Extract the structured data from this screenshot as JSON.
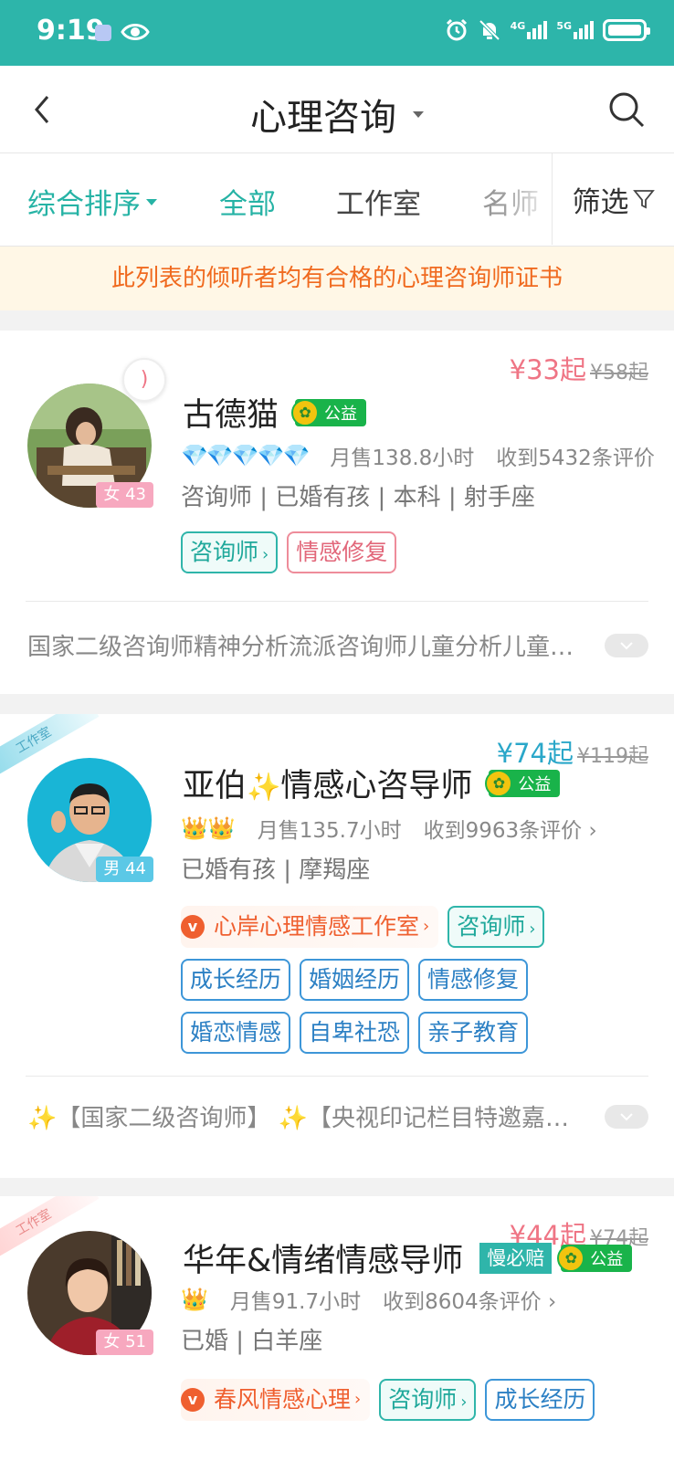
{
  "status_bar": {
    "time": "9:19",
    "net_4g": "4G",
    "net_5g": "5G"
  },
  "nav": {
    "title": "心理咨询"
  },
  "tabs": {
    "sort": "综合排序",
    "all": "全部",
    "studio": "工作室",
    "famous": "名师",
    "filter": "筛选"
  },
  "notice": "此列表的倾听者均有合格的心理咨询师证书",
  "cards": [
    {
      "price_now": "¥33起",
      "price_old": "¥58起",
      "name": "古德猫",
      "public_badge": "公益",
      "gender_age": "女 43",
      "level_icons": "💎💎💎💎💎",
      "monthly_sales": "月售138.8小时",
      "reviews": "收到5432条评价",
      "info": "咨询师 | 已婚有孩 | 本科 | 射手座",
      "tags": [
        "咨询师",
        "情感修复"
      ],
      "intro": "国家二级咨询师精神分析流派咨询师儿童分析儿童成长"
    },
    {
      "ribbon": "工作室",
      "price_now": "¥74起",
      "price_old": "¥119起",
      "name_a": "亚伯",
      "name_b": "情感心咨导师",
      "public_badge": "公益",
      "gender_age": "男 44",
      "level_icons": "👑👑",
      "monthly_sales": "月售135.7小时",
      "reviews": "收到9963条评价 ›",
      "info": "已婚有孩 | 摩羯座",
      "studio": "心岸心理情感工作室",
      "tags": [
        "咨询师",
        "成长经历",
        "婚姻经历",
        "情感修复",
        "婚恋情感",
        "自卑社恐",
        "亲子教育"
      ],
      "intro": "✨【国家二级咨询师】 ✨【央视印记栏目特邀嘉宾】"
    },
    {
      "ribbon": "工作室",
      "price_now": "¥44起",
      "price_old": "¥74起",
      "name": "华年&情绪情感导师",
      "slow_badge": "慢必赔",
      "public_badge": "公益",
      "gender_age": "女 51",
      "level_icons": "👑",
      "monthly_sales": "月售91.7小时",
      "reviews": "收到8604条评价 ›",
      "info": "已婚 | 白羊座",
      "studio": "春风情感心理",
      "tags": [
        "咨询师",
        "成长经历"
      ]
    }
  ],
  "colors": {
    "status_bar": "#2db5aa",
    "accent": "#26b3a5",
    "price_pink": "#ef7585",
    "price_blue": "#2aa7c9",
    "notice_text": "#f06a1f"
  }
}
